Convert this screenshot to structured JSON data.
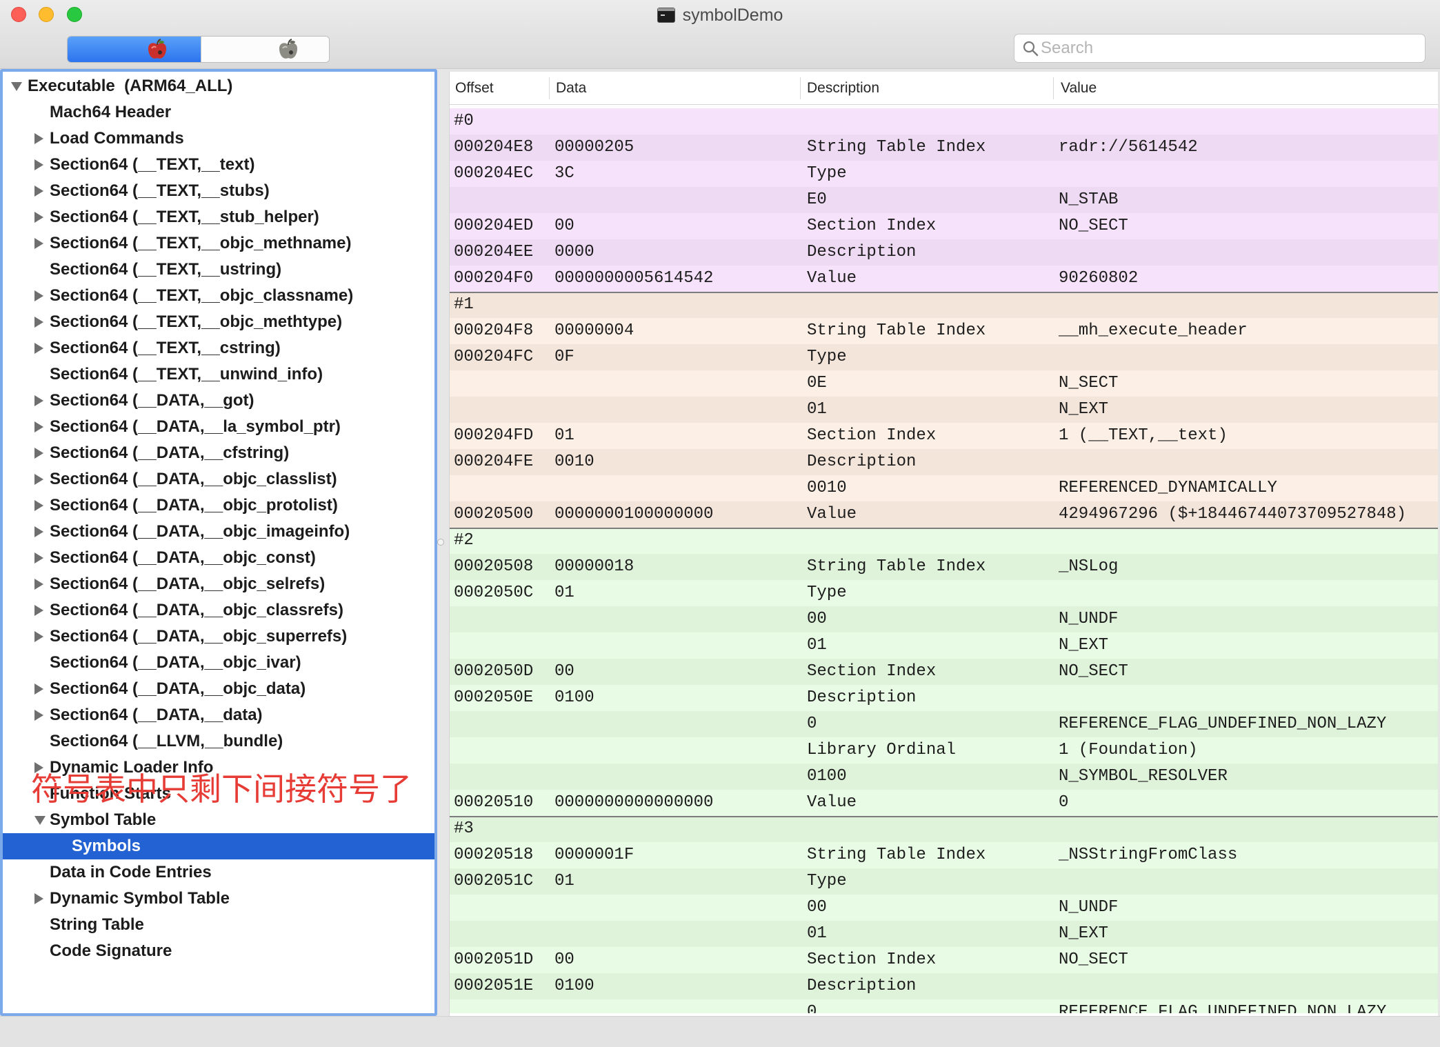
{
  "window": {
    "title": "symbolDemo",
    "title_icon": "terminal-icon"
  },
  "toolbar": {
    "segments": [
      {
        "icon": "red-apple-icon",
        "selected": true
      },
      {
        "icon": "gray-apple-icon",
        "selected": false
      }
    ],
    "search": {
      "icon": "search-icon",
      "placeholder": "Search",
      "value": ""
    }
  },
  "sidebar": {
    "items": [
      {
        "label": "Executable  (ARM64_ALL)",
        "level": 0,
        "disclosure": "expanded"
      },
      {
        "label": "Mach64 Header",
        "level": 1,
        "disclosure": "none"
      },
      {
        "label": "Load Commands",
        "level": 1,
        "disclosure": "collapsed"
      },
      {
        "label": "Section64 (__TEXT,__text)",
        "level": 1,
        "disclosure": "collapsed"
      },
      {
        "label": "Section64 (__TEXT,__stubs)",
        "level": 1,
        "disclosure": "collapsed"
      },
      {
        "label": "Section64 (__TEXT,__stub_helper)",
        "level": 1,
        "disclosure": "collapsed"
      },
      {
        "label": "Section64 (__TEXT,__objc_methname)",
        "level": 1,
        "disclosure": "collapsed"
      },
      {
        "label": "Section64 (__TEXT,__ustring)",
        "level": 1,
        "disclosure": "none"
      },
      {
        "label": "Section64 (__TEXT,__objc_classname)",
        "level": 1,
        "disclosure": "collapsed"
      },
      {
        "label": "Section64 (__TEXT,__objc_methtype)",
        "level": 1,
        "disclosure": "collapsed"
      },
      {
        "label": "Section64 (__TEXT,__cstring)",
        "level": 1,
        "disclosure": "collapsed"
      },
      {
        "label": "Section64 (__TEXT,__unwind_info)",
        "level": 1,
        "disclosure": "none"
      },
      {
        "label": "Section64 (__DATA,__got)",
        "level": 1,
        "disclosure": "collapsed"
      },
      {
        "label": "Section64 (__DATA,__la_symbol_ptr)",
        "level": 1,
        "disclosure": "collapsed"
      },
      {
        "label": "Section64 (__DATA,__cfstring)",
        "level": 1,
        "disclosure": "collapsed"
      },
      {
        "label": "Section64 (__DATA,__objc_classlist)",
        "level": 1,
        "disclosure": "collapsed"
      },
      {
        "label": "Section64 (__DATA,__objc_protolist)",
        "level": 1,
        "disclosure": "collapsed"
      },
      {
        "label": "Section64 (__DATA,__objc_imageinfo)",
        "level": 1,
        "disclosure": "collapsed"
      },
      {
        "label": "Section64 (__DATA,__objc_const)",
        "level": 1,
        "disclosure": "collapsed"
      },
      {
        "label": "Section64 (__DATA,__objc_selrefs)",
        "level": 1,
        "disclosure": "collapsed"
      },
      {
        "label": "Section64 (__DATA,__objc_classrefs)",
        "level": 1,
        "disclosure": "collapsed"
      },
      {
        "label": "Section64 (__DATA,__objc_superrefs)",
        "level": 1,
        "disclosure": "collapsed"
      },
      {
        "label": "Section64 (__DATA,__objc_ivar)",
        "level": 1,
        "disclosure": "none"
      },
      {
        "label": "Section64 (__DATA,__objc_data)",
        "level": 1,
        "disclosure": "collapsed"
      },
      {
        "label": "Section64 (__DATA,__data)",
        "level": 1,
        "disclosure": "collapsed"
      },
      {
        "label": "Section64 (__LLVM,__bundle)",
        "level": 1,
        "disclosure": "none"
      },
      {
        "label": "Dynamic Loader Info",
        "level": 1,
        "disclosure": "collapsed"
      },
      {
        "label": "Function Starts",
        "level": 1,
        "disclosure": "none"
      },
      {
        "label": "Symbol Table",
        "level": 1,
        "disclosure": "expanded"
      },
      {
        "label": "Symbols",
        "level": 2,
        "disclosure": "none",
        "selected": true
      },
      {
        "label": "Data in Code Entries",
        "level": 1,
        "disclosure": "none"
      },
      {
        "label": "Dynamic Symbol Table",
        "level": 1,
        "disclosure": "collapsed"
      },
      {
        "label": "String Table",
        "level": 1,
        "disclosure": "none"
      },
      {
        "label": "Code Signature",
        "level": 1,
        "disclosure": "none"
      }
    ]
  },
  "annotation": {
    "text": "符号表中只剩下间接符号了"
  },
  "table": {
    "columns": [
      "Offset",
      "Data",
      "Description",
      "Value"
    ],
    "groups": [
      {
        "label": "#0",
        "theme": "pink",
        "rows": [
          {
            "offset": "000204E8",
            "data": "00000205",
            "description": "String Table Index",
            "value": "radr://5614542"
          },
          {
            "offset": "000204EC",
            "data": "3C",
            "description": "Type"
          },
          {
            "description": "E0",
            "value": "N_STAB"
          },
          {
            "offset": "000204ED",
            "data": "00",
            "description": "Section Index",
            "value": "NO_SECT"
          },
          {
            "offset": "000204EE",
            "data": "0000",
            "description": "Description"
          },
          {
            "offset": "000204F0",
            "data": "0000000005614542",
            "description": "Value",
            "value": "90260802"
          }
        ]
      },
      {
        "label": "#1",
        "theme": "peach",
        "rows": [
          {
            "offset": "000204F8",
            "data": "00000004",
            "description": "String Table Index",
            "value": "__mh_execute_header"
          },
          {
            "offset": "000204FC",
            "data": "0F",
            "description": "Type"
          },
          {
            "description": "0E",
            "value": "N_SECT"
          },
          {
            "description": "01",
            "value": "N_EXT"
          },
          {
            "offset": "000204FD",
            "data": "01",
            "description": "Section Index",
            "value": "1 (__TEXT,__text)"
          },
          {
            "offset": "000204FE",
            "data": "0010",
            "description": "Description"
          },
          {
            "description": "0010",
            "value": "REFERENCED_DYNAMICALLY"
          },
          {
            "offset": "00020500",
            "data": "0000000100000000",
            "description": "Value",
            "value": "4294967296 ($+18446744073709527848)"
          }
        ]
      },
      {
        "label": "#2",
        "theme": "green",
        "rows": [
          {
            "offset": "00020508",
            "data": "00000018",
            "description": "String Table Index",
            "value": "_NSLog"
          },
          {
            "offset": "0002050C",
            "data": "01",
            "description": "Type"
          },
          {
            "description": "00",
            "value": "N_UNDF"
          },
          {
            "description": "01",
            "value": "N_EXT"
          },
          {
            "offset": "0002050D",
            "data": "00",
            "description": "Section Index",
            "value": "NO_SECT"
          },
          {
            "offset": "0002050E",
            "data": "0100",
            "description": "Description"
          },
          {
            "description": "0",
            "value": "REFERENCE_FLAG_UNDEFINED_NON_LAZY"
          },
          {
            "description": "Library Ordinal",
            "value": "1 (Foundation)"
          },
          {
            "description": "0100",
            "value": "N_SYMBOL_RESOLVER"
          },
          {
            "offset": "00020510",
            "data": "0000000000000000",
            "description": "Value",
            "value": "0"
          }
        ]
      },
      {
        "label": "#3",
        "theme": "green",
        "rows": [
          {
            "offset": "00020518",
            "data": "0000001F",
            "description": "String Table Index",
            "value": "_NSStringFromClass"
          },
          {
            "offset": "0002051C",
            "data": "01",
            "description": "Type"
          },
          {
            "description": "00",
            "value": "N_UNDF"
          },
          {
            "description": "01",
            "value": "N_EXT"
          },
          {
            "offset": "0002051D",
            "data": "00",
            "description": "Section Index",
            "value": "NO_SECT"
          },
          {
            "offset": "0002051E",
            "data": "0100",
            "description": "Description"
          },
          {
            "description": "0",
            "value": "REFERENCE_FLAG_UNDEFINED_NON_LAZY"
          }
        ]
      }
    ]
  },
  "colors": {
    "selection": "#2262d3",
    "focus_ring": "#7ba9ea",
    "annotation": "#e63c35",
    "group_separator": "#7c7c7c",
    "row_themes": {
      "pink": {
        "light": "#f7e2fb",
        "dark": "#efdaf3"
      },
      "peach": {
        "light": "#fcefe5",
        "dark": "#f4e5db"
      },
      "green": {
        "light": "#e8fbe4",
        "dark": "#dff3db"
      }
    }
  }
}
